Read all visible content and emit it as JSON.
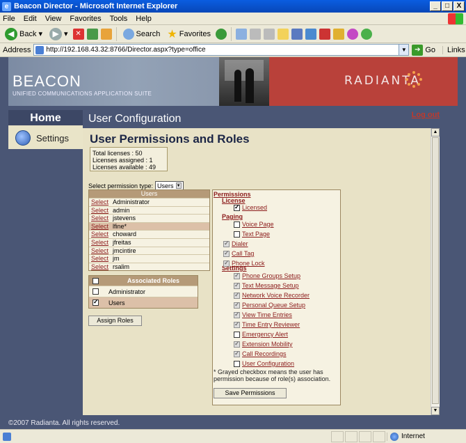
{
  "window": {
    "title": "Beacon Director - Microsoft Internet Explorer",
    "buttons": [
      "_",
      "□",
      "X"
    ]
  },
  "menu": [
    "File",
    "Edit",
    "View",
    "Favorites",
    "Tools",
    "Help"
  ],
  "toolbar": {
    "back": "Back",
    "search": "Search",
    "favorites": "Favorites"
  },
  "address": {
    "label": "Address",
    "url": "http://192.168.43.32:8766/Director.aspx?type=office",
    "go": "Go",
    "links": "Links"
  },
  "banner": {
    "product": "BEACON",
    "tagline": "UNIFIED COMMUNICATIONS APPLICATION SUITE",
    "brand": "RADIANTA"
  },
  "nav": {
    "home": "Home",
    "settings": "Settings"
  },
  "header": {
    "title": "User Configuration",
    "logout": "Log out"
  },
  "main": {
    "heading": "User Permissions and Roles",
    "licenses": {
      "total": "Total licenses : 50",
      "assigned": "Licenses assigned : 1",
      "available": "Licenses available : 49"
    },
    "permission_type_label": "Select permission type:",
    "permission_type_value": "Users",
    "users_header": "Users",
    "select_label": "Select",
    "users": [
      "Administrator",
      "admin",
      "jstevens",
      "lfine*",
      "choward",
      "jfreitas",
      "jmcintire",
      "jm",
      "rsalim"
    ],
    "selected_user_index": 3,
    "roles_header": "Associated Roles",
    "roles": [
      {
        "name": "Administrator",
        "checked": false
      },
      {
        "name": "Users",
        "checked": true
      }
    ],
    "assign_button": "Assign Roles",
    "permissions_header": "Permissions",
    "sections": {
      "license": "License",
      "paging": "Paging",
      "settings": "Settings"
    },
    "perm_license": [
      {
        "name": "Licensed",
        "state": "checked"
      }
    ],
    "perm_paging": [
      {
        "name": "Voice Page",
        "state": "unchecked"
      },
      {
        "name": "Text Page",
        "state": "unchecked"
      }
    ],
    "perm_misc": [
      {
        "name": "Dialer",
        "state": "gray"
      },
      {
        "name": "Call Tag",
        "state": "gray"
      },
      {
        "name": "Phone Lock",
        "state": "gray"
      }
    ],
    "perm_settings": [
      {
        "name": "Phone Groups Setup",
        "state": "gray"
      },
      {
        "name": "Text Message Setup",
        "state": "gray"
      },
      {
        "name": "Network Voice Recorder",
        "state": "gray"
      },
      {
        "name": "Personal Queue Setup",
        "state": "gray"
      },
      {
        "name": "View Time Entries",
        "state": "gray"
      },
      {
        "name": "Time Entry Reviewer",
        "state": "gray"
      },
      {
        "name": "Emergency Alert",
        "state": "unchecked"
      },
      {
        "name": "Extension Mobility",
        "state": "gray"
      },
      {
        "name": "Call Recordings",
        "state": "gray"
      },
      {
        "name": "User Configuration",
        "state": "unchecked"
      }
    ],
    "note": "* Grayed checkbox means the user has permission because of role(s) association.",
    "save_button": "Save Permissions"
  },
  "footer": "©2007 Radianta. All rights reserved.",
  "status": {
    "zone": "Internet"
  }
}
